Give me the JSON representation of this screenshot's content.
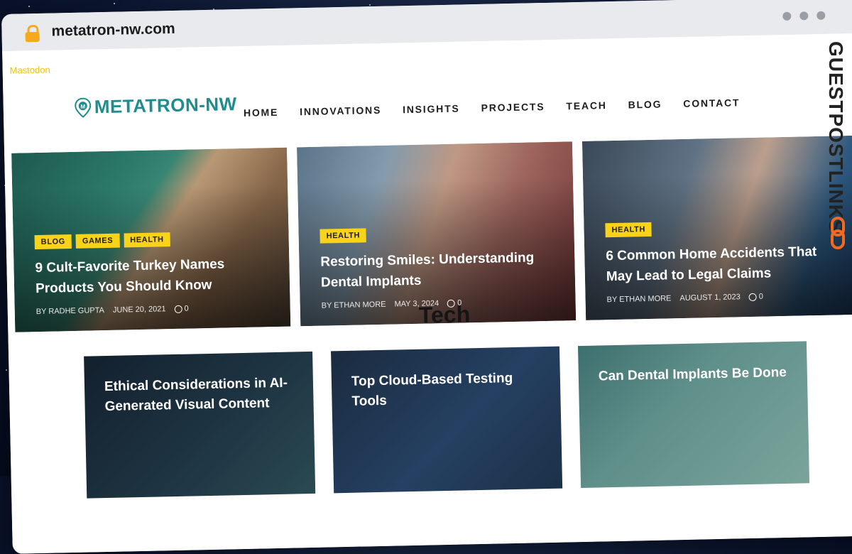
{
  "browser": {
    "url": "metatron-nw.com",
    "lock_icon": "lock-icon"
  },
  "site": {
    "mastodon_link": "Mastodon",
    "logo_text": "METATRON-NW",
    "nav": [
      "HOME",
      "INNOVATIONS",
      "INSIGHTS",
      "PROJECTS",
      "TEACH",
      "BLOG",
      "CONTACT"
    ]
  },
  "hero_cards": [
    {
      "tags": [
        "BLOG",
        "GAMES",
        "HEALTH"
      ],
      "title": "9 Cult-Favorite Turkey Names Products You Should Know",
      "author": "BY RADHE GUPTA",
      "date": "JUNE 20, 2021",
      "comments": "0"
    },
    {
      "tags": [
        "HEALTH"
      ],
      "title": "Restoring Smiles: Understanding Dental Implants",
      "author": "BY ETHAN MORE",
      "date": "MAY 3, 2024",
      "comments": "0"
    },
    {
      "tags": [
        "HEALTH"
      ],
      "title": "6 Common Home Accidents That May Lead to Legal Claims",
      "author": "BY ETHAN MORE",
      "date": "AUGUST 1, 2023",
      "comments": "0"
    }
  ],
  "section": {
    "title": "Tech"
  },
  "tech_cards": [
    {
      "title": "Ethical Considerations in AI-Generated Visual Content"
    },
    {
      "title": "Top Cloud-Based Testing Tools"
    },
    {
      "title": "Can Dental Implants Be Done"
    }
  ],
  "watermark": {
    "text": "GUESTPOSTLINKS"
  },
  "colors": {
    "accent_teal": "#1e8d8e",
    "tag_yellow": "#f9d21a",
    "mastodon_yellow": "#f2c200",
    "lock_orange": "#f4a91f",
    "chain_orange": "#f26a21"
  }
}
